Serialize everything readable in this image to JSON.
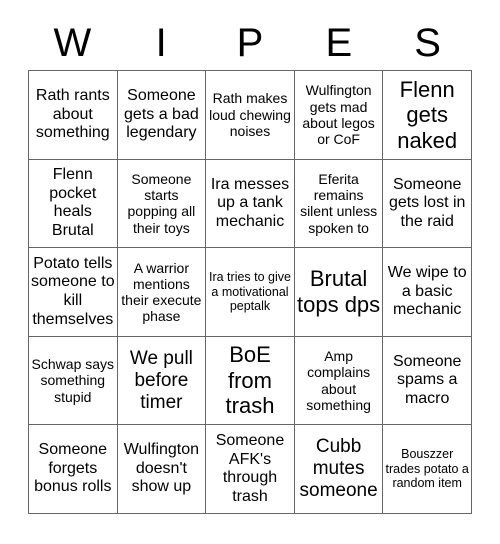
{
  "card": {
    "title_letters": [
      "W",
      "I",
      "P",
      "E",
      "S"
    ],
    "columns": 5,
    "rows": 5,
    "grid_color": "#666666",
    "text_color": "#000000",
    "background_color": "#ffffff",
    "cells": [
      {
        "text": "Rath rants about something",
        "size": "md"
      },
      {
        "text": "Someone gets a bad legendary",
        "size": "md"
      },
      {
        "text": "Rath makes loud chewing noises",
        "size": "sm"
      },
      {
        "text": "Wulfington gets mad about legos or CoF",
        "size": "sm"
      },
      {
        "text": "Flenn gets naked",
        "size": "xl"
      },
      {
        "text": "Flenn pocket heals Brutal",
        "size": "md"
      },
      {
        "text": "Someone starts popping all their toys",
        "size": "sm"
      },
      {
        "text": "Ira messes up a tank mechanic",
        "size": "md"
      },
      {
        "text": "Eferita remains silent unless spoken to",
        "size": "sm"
      },
      {
        "text": "Someone gets lost in the raid",
        "size": "md"
      },
      {
        "text": "Potato tells someone to kill themselves",
        "size": "md"
      },
      {
        "text": "A warrior mentions their execute phase",
        "size": "sm"
      },
      {
        "text": "Ira tries to give a motivational peptalk",
        "size": "xs"
      },
      {
        "text": "Brutal tops dps",
        "size": "xl"
      },
      {
        "text": "We wipe to a basic mechanic",
        "size": "md"
      },
      {
        "text": "Schwap says something stupid",
        "size": "sm"
      },
      {
        "text": "We pull before timer",
        "size": "lg"
      },
      {
        "text": "BoE from trash",
        "size": "xl"
      },
      {
        "text": "Amp complains about something",
        "size": "sm"
      },
      {
        "text": "Someone spams a macro",
        "size": "md"
      },
      {
        "text": "Someone forgets bonus rolls",
        "size": "md"
      },
      {
        "text": "Wulfington doesn't show up",
        "size": "md"
      },
      {
        "text": "Someone AFK's through trash",
        "size": "md"
      },
      {
        "text": "Cubb mutes someone",
        "size": "lg"
      },
      {
        "text": "Bouszzer trades potato a random item",
        "size": "xs"
      }
    ]
  }
}
